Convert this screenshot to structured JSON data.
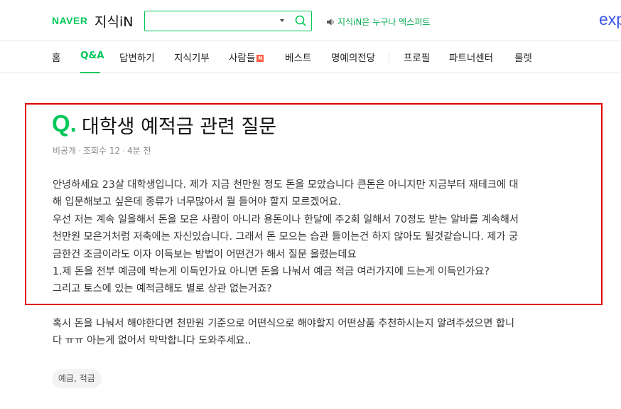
{
  "header": {
    "logo_brand": "NAVER",
    "logo_service": "지식iN",
    "search": {
      "value": "",
      "placeholder": ""
    },
    "notice": "지식iN은 누구나 엑스퍼트",
    "expert_logo": "exp"
  },
  "nav": {
    "items": [
      {
        "label": "홈"
      },
      {
        "label": "Q&A",
        "active": true
      },
      {
        "label": "답변하기"
      },
      {
        "label": "지식기부"
      },
      {
        "label": "사람들",
        "badge": "N"
      },
      {
        "label": "베스트"
      },
      {
        "label": "명예의전당"
      },
      {
        "label": "프로필"
      },
      {
        "label": "파트너센터"
      },
      {
        "label": "룰렛"
      }
    ]
  },
  "question": {
    "prefix": "Q.",
    "title": "대학생 예적금 관련 질문",
    "meta": {
      "author": "비공개",
      "views": "조회수 12",
      "time": "4분 전"
    },
    "body_lines": [
      "안녕하세요 23살 대학생입니다. 제가 지금 천만원 정도 돈을 모았습니다 큰돈은 아니지만 지금부터 재테크에 대",
      "해 입문해보고 싶은데 종류가 너무많아서 뭘 들어야 할지 모르겠어요.",
      "우선 저는 계속 일을해서 돈을 모은 사람이 아니라 용돈이나 한달에 주2회 일해서 70정도 받는 알바를 계속해서",
      "천만원 모은거처럼 저축에는 자신있습니다. 그래서 돈 모으는 습관 들이는건 하지 않아도 될것같습니다. 제가 궁",
      "금한건 조금이라도 이자 이득보는 방법이 어떤건가 해서 질문 올렸는데요",
      "1.제 돈을 전부 예금에 박는게 이득인가요 아니면 돈을 나눠서 예금 적금 여러가지에 드는게 이득인가요?",
      "그리고 토스에 있는 예적금해도 별로 상관 없는거죠?"
    ],
    "extra_lines": [
      "혹시 돈을 나눠서 해야한다면 천만원 기준으로 어떤식으로 해야할지 어떤상품 추천하시는지 알려주셨으면 합니",
      "다 ㅠㅠ 아는게 없어서 막막합니다 도와주세요.."
    ],
    "tag": "예금, 적금"
  },
  "colors": {
    "brand_green": "#03c75a",
    "highlight_red": "#e00000",
    "expert_blue": "#3b56e6"
  },
  "icons": [
    "search-icon",
    "chevron-down-icon",
    "speaker-icon",
    "new-badge-icon"
  ]
}
